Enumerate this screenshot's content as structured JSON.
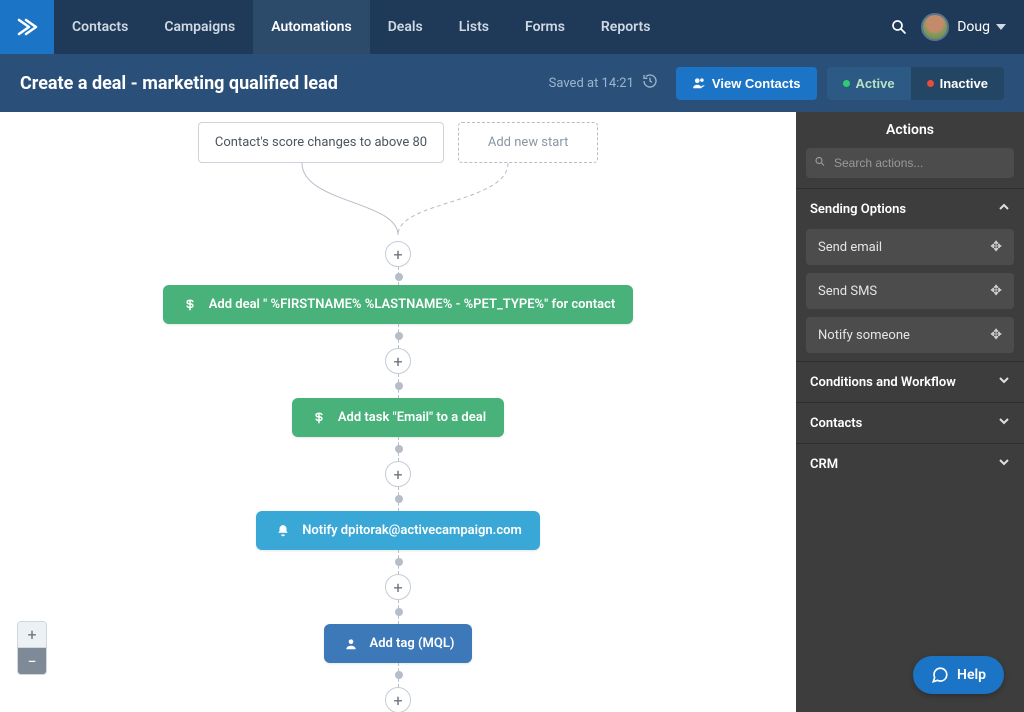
{
  "nav": {
    "items": [
      "Contacts",
      "Campaigns",
      "Automations",
      "Deals",
      "Lists",
      "Forms",
      "Reports"
    ],
    "active_index": 2
  },
  "user": {
    "name": "Doug"
  },
  "page": {
    "title": "Create a deal - marketing qualified lead",
    "saved_text": "Saved at 14:21",
    "view_contacts_label": "View Contacts",
    "active_label": "Active",
    "inactive_label": "Inactive"
  },
  "flow": {
    "trigger_label": "Contact's score changes to above 80",
    "add_trigger_label": "Add new start",
    "steps": [
      {
        "color": "green",
        "icon": "dollar",
        "label": "Add deal \" %FIRSTNAME% %LASTNAME% - %PET_TYPE%\" for contact"
      },
      {
        "color": "green",
        "icon": "dollar",
        "label": "Add task \"Email\" to a deal"
      },
      {
        "color": "blue",
        "icon": "bell",
        "label": "Notify dpitorak@activecampaign.com"
      },
      {
        "color": "navy",
        "icon": "user",
        "label": "Add tag (MQL)"
      }
    ]
  },
  "sidebar": {
    "title": "Actions",
    "search_placeholder": "Search actions...",
    "groups": [
      {
        "label": "Sending Options",
        "expanded": true,
        "items": [
          "Send email",
          "Send SMS",
          "Notify someone"
        ]
      },
      {
        "label": "Conditions and Workflow",
        "expanded": false
      },
      {
        "label": "Contacts",
        "expanded": false
      },
      {
        "label": "CRM",
        "expanded": false
      }
    ]
  },
  "help_label": "Help"
}
